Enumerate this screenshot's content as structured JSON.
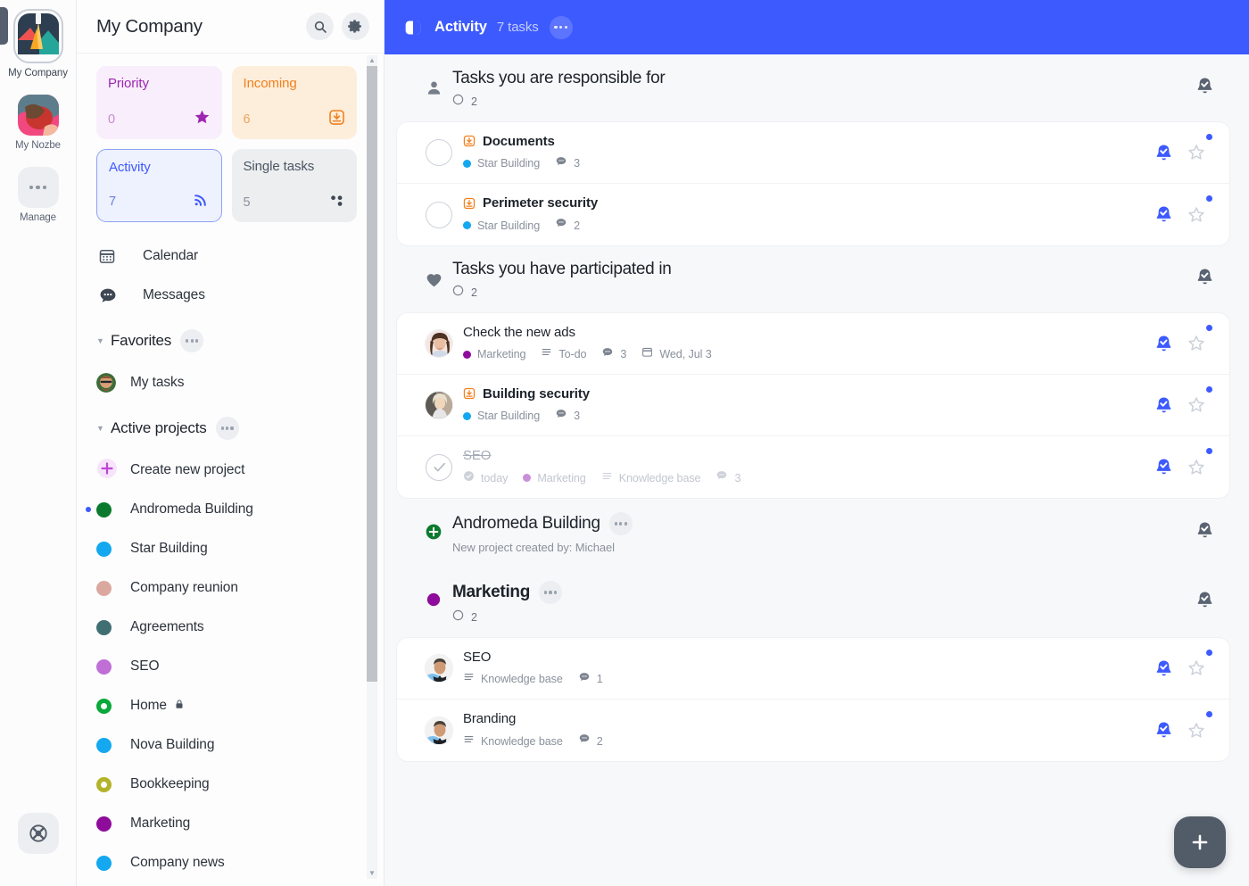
{
  "colors": {
    "accent": "#3d5afe",
    "priority": "#9c27b0",
    "incoming": "#f27f1d",
    "single": "#4b5563",
    "star_building": "#1aa8ef",
    "marketing": "#8e0b9b",
    "andromeda": "#0b7a2e",
    "seo": "#bf6fd6",
    "company_reunion": "#dba8a0",
    "agreements": "#3f6f73",
    "bookkeeping": "#b3b32a",
    "nova_building": "#13a8ef",
    "company_news": "#13a8ef",
    "home": "#0ba83c"
  },
  "rail": {
    "workspaces": [
      {
        "label": "My Company",
        "icon": "handshake-avatar",
        "active": true
      },
      {
        "label": "My Nozbe",
        "icon": "abstract-avatar",
        "active": false
      },
      {
        "label": "Manage",
        "icon": "ellipsis-icon",
        "active": false
      }
    ],
    "help_icon": "lifebuoy-icon"
  },
  "sidebar": {
    "title": "My Company",
    "search_icon": "search-icon",
    "settings_icon": "gear-icon",
    "tiles": [
      {
        "name": "Priority",
        "count": "0",
        "icon": "star-icon",
        "variant": "t-priority"
      },
      {
        "name": "Incoming",
        "count": "6",
        "icon": "inbox-download-icon",
        "variant": "t-incoming"
      },
      {
        "name": "Activity",
        "count": "7",
        "icon": "rss-activity-icon",
        "variant": "t-activity"
      },
      {
        "name": "Single tasks",
        "count": "5",
        "icon": "scatter-dots-icon",
        "variant": "t-single"
      }
    ],
    "nav": [
      {
        "label": "Calendar",
        "icon": "calendar-icon"
      },
      {
        "label": "Messages",
        "icon": "chat-bubble-icon"
      }
    ],
    "favorites": {
      "title": "Favorites",
      "menu_icon": "ellipsis-icon",
      "items": [
        {
          "label": "My tasks",
          "icon": "user-avatar"
        }
      ]
    },
    "active_projects": {
      "title": "Active projects",
      "menu_icon": "ellipsis-icon",
      "create_label": "Create new project",
      "create_icon": "plus-icon",
      "items": [
        {
          "label": "Andromeda Building",
          "color": "#0b7a2e",
          "style": "solid",
          "unread": true,
          "locked": false
        },
        {
          "label": "Star Building",
          "color": "#13a8ef",
          "style": "solid",
          "unread": false,
          "locked": false
        },
        {
          "label": "Company reunion",
          "color": "#dba8a0",
          "style": "solid",
          "unread": false,
          "locked": false
        },
        {
          "label": "Agreements",
          "color": "#3f6f73",
          "style": "solid",
          "unread": false,
          "locked": false
        },
        {
          "label": "SEO",
          "color": "#bf6fd6",
          "style": "solid",
          "unread": false,
          "locked": false
        },
        {
          "label": "Home",
          "color": "#0ba83c",
          "style": "ring",
          "unread": false,
          "locked": true
        },
        {
          "label": "Nova Building",
          "color": "#13a8ef",
          "style": "solid",
          "unread": false,
          "locked": false
        },
        {
          "label": "Bookkeeping",
          "color": "#b3b32a",
          "style": "ring",
          "unread": false,
          "locked": false
        },
        {
          "label": "Marketing",
          "color": "#8e0b9b",
          "style": "solid",
          "unread": false,
          "locked": false
        },
        {
          "label": "Company news",
          "color": "#13a8ef",
          "style": "solid",
          "unread": false,
          "locked": false
        }
      ]
    }
  },
  "topbar": {
    "panel_icon": "panel-toggle-icon",
    "title": "Activity",
    "subtitle": "7 tasks",
    "menu_icon": "ellipsis-icon"
  },
  "groups": [
    {
      "id": "responsible",
      "icon": "person-icon",
      "title": "Tasks you are responsible for",
      "title_bold": false,
      "count": "2",
      "count_icon": "circle-outline-icon",
      "subtitle": null,
      "menu": false,
      "bell_icon": "bell-check-icon",
      "tasks": [
        {
          "title": "Documents",
          "bold": true,
          "struck": false,
          "left": "checkbox",
          "inbox_icon": true,
          "unread": true,
          "chips": [
            {
              "type": "dot",
              "color": "#13a8ef",
              "text": "Star Building"
            },
            {
              "type": "comment",
              "text": "3"
            }
          ]
        },
        {
          "title": "Perimeter security",
          "bold": true,
          "struck": false,
          "left": "checkbox",
          "inbox_icon": true,
          "unread": true,
          "chips": [
            {
              "type": "dot",
              "color": "#13a8ef",
              "text": "Star Building"
            },
            {
              "type": "comment",
              "text": "2"
            }
          ]
        }
      ]
    },
    {
      "id": "participated",
      "icon": "heart-icon",
      "title": "Tasks you have participated in",
      "title_bold": false,
      "count": "2",
      "count_icon": "circle-outline-icon",
      "subtitle": null,
      "menu": false,
      "bell_icon": "bell-check-icon",
      "tasks": [
        {
          "title": "Check the new ads",
          "bold": false,
          "struck": false,
          "left": "avatar-woman",
          "inbox_icon": false,
          "unread": true,
          "chips": [
            {
              "type": "dot",
              "color": "#8e0b9b",
              "text": "Marketing"
            },
            {
              "type": "list",
              "text": "To-do"
            },
            {
              "type": "comment",
              "text": "3"
            },
            {
              "type": "date",
              "text": "Wed, Jul 3"
            }
          ]
        },
        {
          "title": "Building security",
          "bold": true,
          "struck": false,
          "left": "avatar-blonde",
          "inbox_icon": true,
          "unread": true,
          "chips": [
            {
              "type": "dot",
              "color": "#13a8ef",
              "text": "Star Building"
            },
            {
              "type": "comment",
              "text": "3"
            }
          ]
        },
        {
          "title": "SEO",
          "bold": false,
          "struck": true,
          "left": "checkbox-done",
          "inbox_icon": false,
          "unread": true,
          "faded": true,
          "chips": [
            {
              "type": "check",
              "text": "today"
            },
            {
              "type": "dot",
              "color": "#c98fd9",
              "text": "Marketing"
            },
            {
              "type": "list",
              "text": "Knowledge base"
            },
            {
              "type": "comment",
              "text": "3"
            }
          ]
        }
      ]
    },
    {
      "id": "andromeda",
      "icon": "plus-circle-green-icon",
      "title": "Andromeda Building",
      "title_bold": false,
      "count": null,
      "count_icon": null,
      "subtitle": "New project created by: Michael",
      "menu": true,
      "menu_icon": "ellipsis-icon",
      "bell_icon": "bell-check-icon",
      "tasks": []
    },
    {
      "id": "marketing",
      "icon": "purple-dot-icon",
      "title": "Marketing",
      "title_bold": true,
      "count": "2",
      "count_icon": "circle-outline-icon",
      "subtitle": null,
      "menu": true,
      "menu_icon": "ellipsis-icon",
      "bell_icon": "bell-check-icon",
      "tasks": [
        {
          "title": "SEO",
          "bold": false,
          "struck": false,
          "left": "avatar-man",
          "inbox_icon": false,
          "unread": true,
          "chips": [
            {
              "type": "list",
              "text": "Knowledge base"
            },
            {
              "type": "comment",
              "text": "1"
            }
          ]
        },
        {
          "title": "Branding",
          "bold": false,
          "struck": false,
          "left": "avatar-man",
          "inbox_icon": false,
          "unread": true,
          "chips": [
            {
              "type": "list",
              "text": "Knowledge base"
            },
            {
              "type": "comment",
              "text": "2"
            }
          ]
        }
      ]
    }
  ],
  "fab": {
    "icon": "plus-icon"
  }
}
